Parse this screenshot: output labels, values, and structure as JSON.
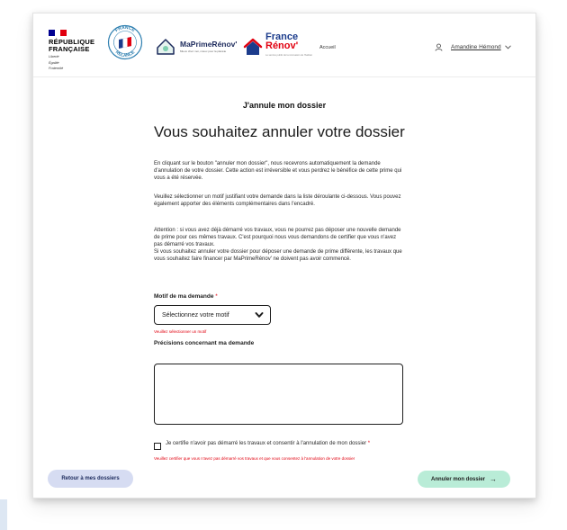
{
  "header": {
    "republique_lines": [
      "RÉPUBLIQUE",
      "FRANÇAISE"
    ],
    "motto_lines": [
      "Liberté",
      "Égalité",
      "Fraternité"
    ],
    "relance_text": [
      "FRANCE",
      "RELANCE"
    ],
    "maprimerenov_name": "MaPrimeRénov'",
    "maprimerenov_tagline": "Mieux chez moi, mieux pour la planète",
    "france_renov_line1": "France",
    "france_renov_line2": "Rénov'",
    "france_renov_tagline": "Le service public de la rénovation de l'habitat",
    "nav_accueil": "Accueil",
    "user_name": "Amandine Hémond"
  },
  "page": {
    "heading": "J'annule mon dossier",
    "title": "Vous souhaitez annuler votre dossier",
    "paragraph1": "En cliquant sur le bouton \"annuler mon dossier\", nous recevrons automatiquement la demande d'annulation de votre dossier. Cette action est irréversible et vous perdrez le bénéfice de cette prime qui vous a été réservée.",
    "paragraph2": "Veuillez sélectionner un motif justifiant votre demande dans la liste déroulante ci-dessous. Vous pouvez également apporter des éléments complémentaires dans l'encadré.",
    "paragraph3_a": "Attention : si vous avez déjà démarré vos travaux, vous ne pourrez pas déposer une nouvelle demande de prime pour ces mêmes travaux. C'est pourquoi nous vous demandons de certifier que vous n'avez pas démarré vos travaux.",
    "paragraph3_b": "Si vous souhaitez annuler votre dossier pour déposer une demande de prime différente, les travaux que vous souhaitez faire financer par MaPrimeRénov' ne doivent pas avoir commencé."
  },
  "form": {
    "motif_label": "Motif de ma demande",
    "required_mark": "*",
    "select_value": "Sélectionnez votre motif",
    "select_error": "Veuillez sélectionner un motif",
    "precisions_label": "Précisions concernant ma demande",
    "certify_label": "Je certifie n'avoir pas démarré les travaux et consentir à l'annulation de mon dossier",
    "certify_error": "Veuillez certifier que vous n'avez pas démarré vos travaux et que vous consentez à l'annulation de votre dossier"
  },
  "footer": {
    "back_button": "Retour à mes dossiers",
    "cancel_button": "Annuler mon dossier",
    "cancel_arrow": "→"
  },
  "colors": {
    "brand_blue": "#1c2a5c",
    "france_blue": "#1c3c8c",
    "marianne_red": "#e1000f",
    "back_button_bg": "#d6dcf2",
    "cancel_button_bg": "#b9ecd7"
  },
  "icons": [
    "marianne-flag-icon",
    "france-relance-logo",
    "maprimerenov-logo-icon",
    "france-renov-logo-icon",
    "user-icon",
    "chevron-down-icon",
    "arrow-right-icon"
  ]
}
